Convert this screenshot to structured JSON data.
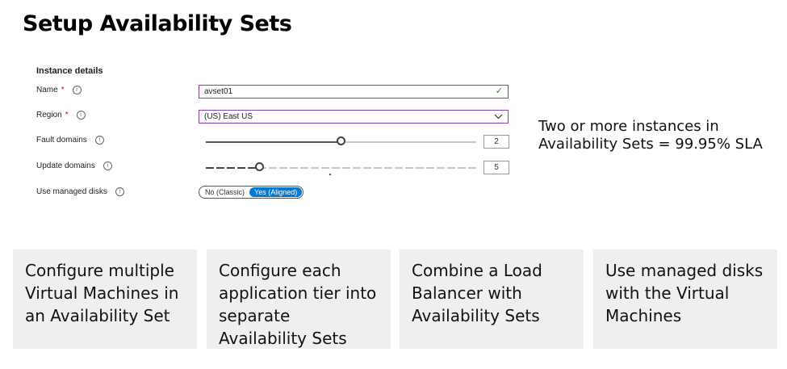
{
  "page": {
    "title": "Setup Availability Sets"
  },
  "form": {
    "section_title": "Instance details",
    "name": {
      "label": "Name",
      "required_mark": "*",
      "value": "avset01"
    },
    "region": {
      "label": "Region",
      "required_mark": "*",
      "value": "(US) East US"
    },
    "fault_domains": {
      "label": "Fault domains",
      "value": "2",
      "level": 0.5
    },
    "update_domains": {
      "label": "Update domains",
      "value": "5",
      "level": 0.2
    },
    "managed_disks": {
      "label": "Use managed disks",
      "options": [
        "No (Classic)",
        "Yes (Aligned)"
      ],
      "selected": "Yes (Aligned)"
    }
  },
  "note": {
    "line1": "Two or more instances in",
    "line2": "Availability Sets = 99.95% SLA"
  },
  "cards": [
    {
      "text": "Configure multiple Virtual Machines in an Availability Set"
    },
    {
      "text": "Configure each application tier into separate Availability Sets"
    },
    {
      "text": "Combine a Load Balancer with Availability Sets"
    },
    {
      "text": "Use managed disks with the Virtual Machines"
    }
  ],
  "colors": {
    "accent": "#0078d4",
    "field_border": "#8a3fb4",
    "card_bg": "#efefef",
    "required": "#a4262c",
    "check": "#2e8b20"
  },
  "icons": {
    "info": "info-icon",
    "check": "check-icon",
    "dropdown": "chevron-down-icon"
  }
}
